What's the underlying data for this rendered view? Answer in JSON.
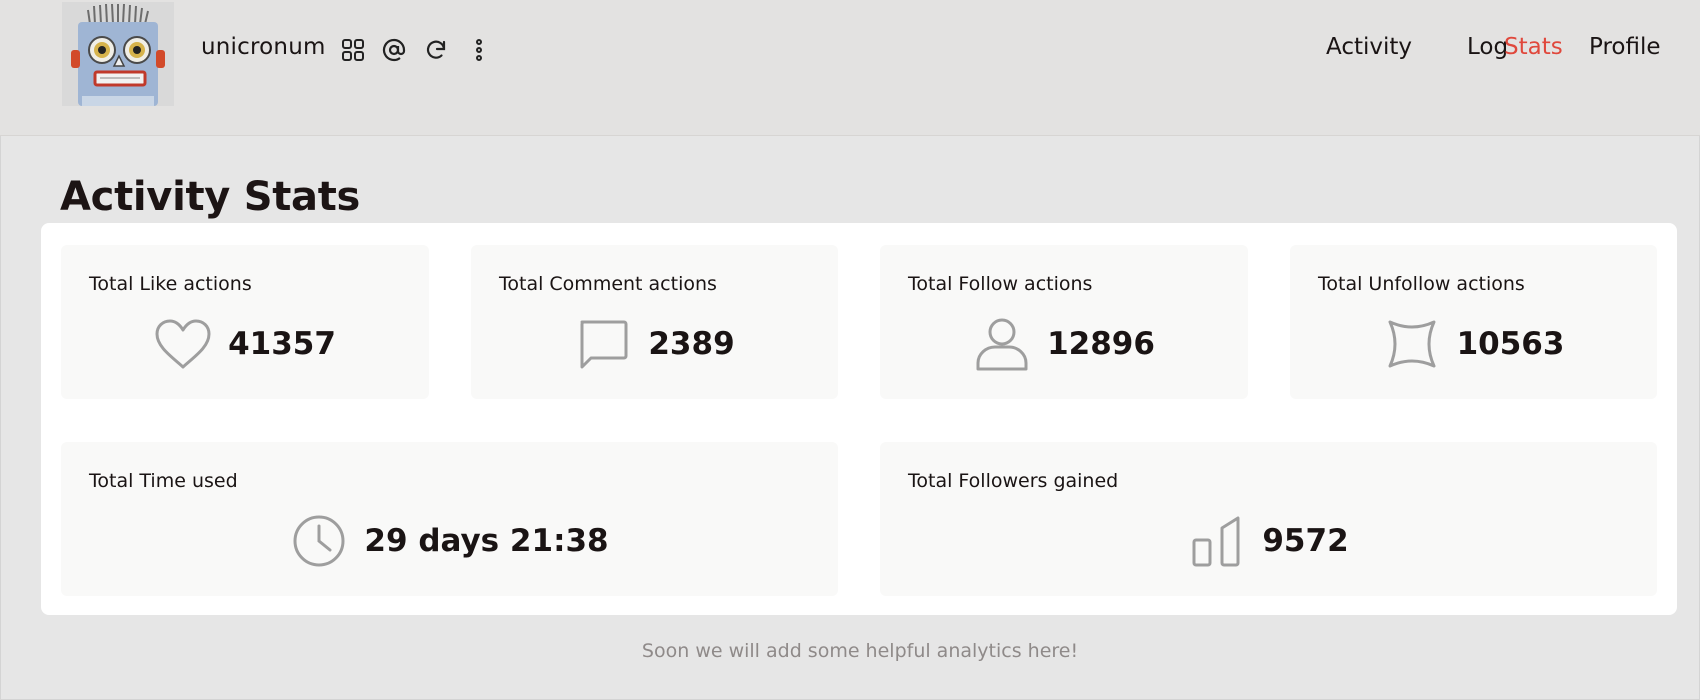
{
  "header": {
    "username": "unicronum",
    "icons": [
      "apps-grid-icon",
      "at-sign-icon",
      "refresh-icon",
      "more-vertical-icon"
    ],
    "nav": [
      {
        "label": "Activity",
        "active": false
      },
      {
        "label": "Log",
        "active": false
      },
      {
        "label": "Stats",
        "active": true
      },
      {
        "label": "Profile",
        "active": false
      }
    ]
  },
  "page": {
    "title": "Activity Stats"
  },
  "stats": {
    "like": {
      "label": "Total Like actions",
      "value": "41357",
      "icon": "heart-icon"
    },
    "comment": {
      "label": "Total Comment actions",
      "value": "2389",
      "icon": "comment-icon"
    },
    "follow": {
      "label": "Total Follow actions",
      "value": "12896",
      "icon": "user-icon"
    },
    "unfollow": {
      "label": "Total Unfollow actions",
      "value": "10563",
      "icon": "unfollow-x-icon"
    },
    "time": {
      "label": "Total Time used",
      "value": "29 days 21:38",
      "icon": "clock-icon"
    },
    "followers": {
      "label": "Total Followers gained",
      "value": "9572",
      "icon": "bar-chart-icon"
    }
  },
  "footer": {
    "note": "Soon we will add some helpful analytics here!"
  },
  "colors": {
    "accent": "#e0483c",
    "background": "#e6e6e6",
    "card": "#f9f9f8",
    "icon_stroke": "#9e9e9e"
  }
}
